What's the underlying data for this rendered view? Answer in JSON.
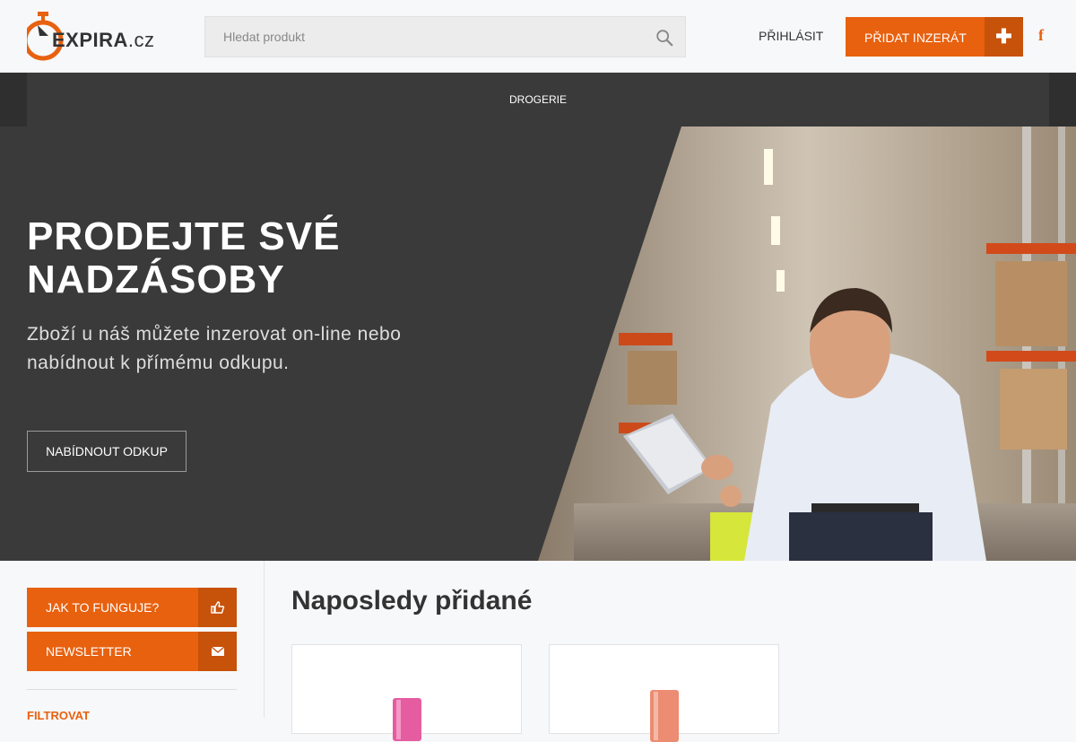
{
  "header": {
    "logo_text": "EXPIRA",
    "logo_suffix": ".cz",
    "search_placeholder": "Hledat produkt",
    "login_label": "PŘIHLÁSIT",
    "add_listing_label": "PŘIDAT INZERÁT",
    "add_icon": "plus-icon",
    "social_icon": "facebook-icon"
  },
  "nav": {
    "categories": [
      "DROGERIE"
    ]
  },
  "hero": {
    "title": "PRODEJTE SVÉ NADZÁSOBY",
    "subtitle": "Zboží u náš můžete inzerovat on-line nebo nabídnout k přímému odkupu.",
    "button_label": "NABÍDNOUT ODKUP"
  },
  "sidebar": {
    "how_it_works_label": "JAK TO FUNGUJE?",
    "how_it_works_icon": "thumbs-up-icon",
    "newsletter_label": "NEWSLETTER",
    "newsletter_icon": "envelope-icon",
    "filter_label": "FILTROVAT"
  },
  "main": {
    "title": "Naposledy přidané"
  },
  "colors": {
    "accent": "#e8610f",
    "accent_dark": "#c7520a",
    "dark": "#3a3a3a"
  }
}
